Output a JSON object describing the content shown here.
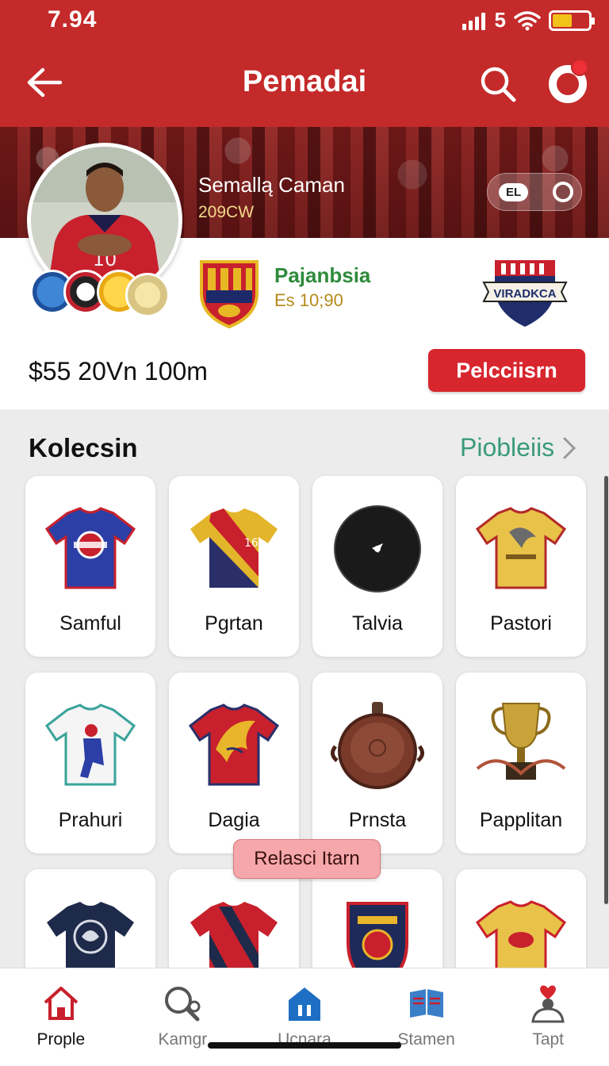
{
  "status_bar": {
    "time": "7.94",
    "signal_label": "5"
  },
  "app_bar": {
    "title": "Pemadai"
  },
  "profile": {
    "player_name": "Semallą Caman",
    "player_sub": "209CW",
    "hero_chip_badge": "EL",
    "club_name": "Pajanbsia",
    "club_meta": "Es 10;90",
    "opponent_crest_text": "VIRADKCA",
    "value_text": "$55 20Vn 100m",
    "action_button": "Pelcciisrn"
  },
  "collection": {
    "title": "Kolecsin",
    "link": "Piobleiis",
    "items": [
      {
        "label": "Samful",
        "icon": "blue-jersey-icon"
      },
      {
        "label": "Pgrtan",
        "icon": "yellow-red-jersey-icon"
      },
      {
        "label": "Talvia",
        "icon": "black-cap-icon"
      },
      {
        "label": "Pastori",
        "icon": "yellow-jersey-icon"
      },
      {
        "label": "Prahuri",
        "icon": "white-jersey-icon"
      },
      {
        "label": "Dagia",
        "icon": "red-dragon-jersey-icon"
      },
      {
        "label": "Prnsta",
        "icon": "copper-pan-icon"
      },
      {
        "label": "Papplitan",
        "icon": "trophy-icon"
      },
      {
        "label": "",
        "icon": "navy-jersey-icon"
      },
      {
        "label": "",
        "icon": "striped-jersey-icon"
      },
      {
        "label": "",
        "icon": "crest-patch-icon"
      },
      {
        "label": "",
        "icon": "yellow-jersey-icon"
      }
    ],
    "tooltip": "Relasci Itarn"
  },
  "bottom_nav": [
    {
      "label": "Prople",
      "icon": "home-icon",
      "active": true
    },
    {
      "label": "Kamgr",
      "icon": "search-user-icon",
      "active": false
    },
    {
      "label": "Ucnara",
      "icon": "store-icon",
      "active": false
    },
    {
      "label": "Stamen",
      "icon": "book-icon",
      "active": false
    },
    {
      "label": "Tapt",
      "icon": "profile-heart-icon",
      "active": false
    }
  ],
  "colors": {
    "primary_red": "#c42a2a",
    "button_red": "#d8262e",
    "link_green": "#3a9b7a",
    "club_green": "#2e8b3b"
  }
}
